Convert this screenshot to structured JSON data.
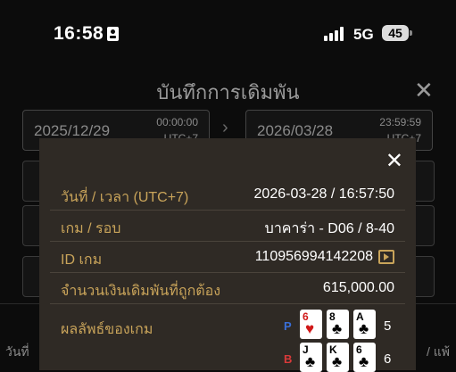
{
  "status_bar": {
    "time": "16:58",
    "network": "5G",
    "battery": "45",
    "id_icon": "id-card-icon",
    "signal_icon": "signal-bars-icon"
  },
  "page": {
    "title": "บันทึกการเดิมพัน",
    "close_icon": "close-icon",
    "start_date": "2025/12/29",
    "start_time": "00:00:00",
    "start_tz": "UTC+7",
    "end_date": "2026/03/28",
    "end_time": "23:59:59",
    "end_tz": "UTC+7",
    "footer_left": "วันที่",
    "footer_right": "/ แพ้"
  },
  "modal": {
    "close_icon": "close-icon",
    "rows": [
      {
        "label": "วันที่ / เวลา (UTC+7)",
        "value": "2026-03-28 / 16:57:50"
      },
      {
        "label": "เกม / รอบ",
        "value": "บาคาร่า - D06 / 8-40"
      },
      {
        "label": "ID เกม",
        "value": "110956994142208"
      },
      {
        "label": "จำนวนเงินเดิมพันที่ถูกต้อง",
        "value": "615,000.00"
      },
      {
        "label": "ผลลัพธ์ของเกม",
        "value": ""
      }
    ],
    "result": {
      "player_label": "P",
      "player_cards": [
        {
          "rank": "6",
          "suit": "♥"
        },
        {
          "rank": "8",
          "suit": "♣"
        },
        {
          "rank": "A",
          "suit": "♣"
        }
      ],
      "player_score": "5",
      "banker_label": "B",
      "banker_cards": [
        {
          "rank": "J",
          "suit": "♣"
        },
        {
          "rank": "K",
          "suit": "♣"
        },
        {
          "rank": "6",
          "suit": "♣"
        }
      ],
      "banker_score": "6"
    }
  }
}
